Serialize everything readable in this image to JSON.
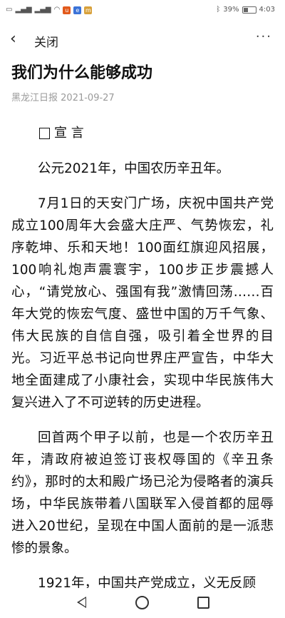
{
  "status_bar": {
    "left_icons": [
      "sim-card-icon",
      "signal-icon",
      "signal-icon",
      "wifi-icon",
      "app-badge-icon",
      "app-badge-icon",
      "app-badge-icon"
    ],
    "right_icons": [
      "bluetooth-icon"
    ],
    "battery_percent": "39%",
    "battery_level": 0.39,
    "time": "4:03"
  },
  "navbar": {
    "back_icon": "‹",
    "close_label": "关闭",
    "more_icon": "···"
  },
  "article": {
    "title": "我们为什么能够成功",
    "source": "黑龙江日报",
    "date": "2021-09-27",
    "author": "宣 言",
    "paragraphs": [
      "公元2021年，中国农历辛丑年。",
      "7月1日的天安门广场，庆祝中国共产党成立100周年大会盛大庄严、气势恢宏，礼序乾坤、乐和天地！100面红旗迎风招展，100响礼炮声震寰宇，100步正步震撼人心，“请党放心、强国有我”激情回荡……百年大党的恢宏气度、盛世中国的万千气象、伟大民族的自信自强，吸引着全世界的目光。习近平总书记向世界庄严宣告，中华大地全面建成了小康社会，实现中华民族伟大复兴进入了不可逆转的历史进程。",
      "回首两个甲子以前，也是一个农历辛丑年，清政府被迫签订丧权辱国的《辛丑条约》，那时的太和殿广场已沦为侵略者的演兵场，中华民族带着八国联军入侵首都的屈辱进入20世纪，呈现在中国人面前的是一派悲惨的景象。",
      "1921年，中国共产党成立，义无反顾"
    ]
  },
  "bottom_nav": {
    "back_icon": "triangle-back-icon",
    "home_icon": "circle-home-icon",
    "recent_icon": "square-recent-icon"
  }
}
